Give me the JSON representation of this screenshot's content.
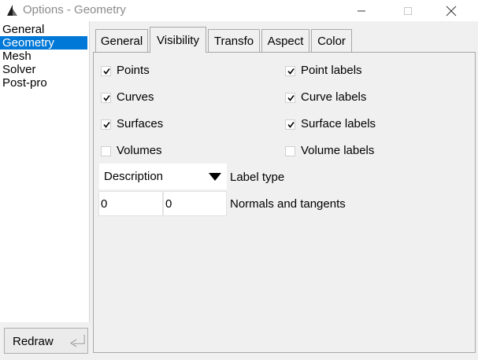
{
  "window": {
    "title": "Options - Geometry",
    "controls": {
      "minimize": "minimize-icon",
      "maximize": "maximize-icon",
      "close": "close-icon"
    }
  },
  "sidebar": {
    "items": [
      {
        "label": "General",
        "selected": false
      },
      {
        "label": "Geometry",
        "selected": true
      },
      {
        "label": "Mesh",
        "selected": false
      },
      {
        "label": "Solver",
        "selected": false
      },
      {
        "label": "Post-pro",
        "selected": false
      }
    ]
  },
  "redraw": {
    "label": "Redraw",
    "icon": "enter-icon"
  },
  "tabs": [
    {
      "label": "General",
      "active": false
    },
    {
      "label": "Visibility",
      "active": true
    },
    {
      "label": "Transfo",
      "active": false
    },
    {
      "label": "Aspect",
      "active": false
    },
    {
      "label": "Color",
      "active": false
    }
  ],
  "visibility": {
    "left": [
      {
        "label": "Points",
        "checked": true
      },
      {
        "label": "Curves",
        "checked": true
      },
      {
        "label": "Surfaces",
        "checked": true
      },
      {
        "label": "Volumes",
        "checked": false
      }
    ],
    "right": [
      {
        "label": "Point labels",
        "checked": true
      },
      {
        "label": "Curve labels",
        "checked": true
      },
      {
        "label": "Surface labels",
        "checked": true
      },
      {
        "label": "Volume labels",
        "checked": false
      }
    ],
    "label_type": {
      "value": "Description",
      "label": "Label type"
    },
    "normals": {
      "value1": "0",
      "value2": "0",
      "label": "Normals and tangents"
    }
  },
  "colors": {
    "selection": "#0078d7",
    "panel": "#f0f0f0"
  }
}
